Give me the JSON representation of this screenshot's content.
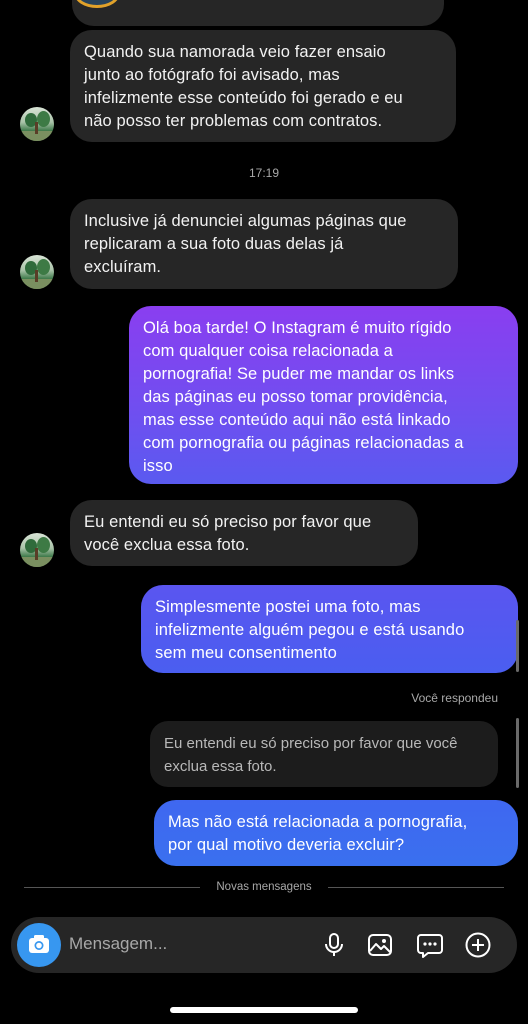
{
  "conversation": {
    "messages": [
      {
        "id": "m1",
        "direction": "incoming",
        "text": "Quando sua namorada veio  fazer ensaio\njunto ao fotógrafo foi avisado, mas\ninfelizmente esse conteúdo foi gerado e eu\nnão posso ter problemas com contratos."
      },
      {
        "id": "m2",
        "direction": "incoming",
        "text": "Inclusive já denunciei algumas páginas que\nreplicaram a sua foto duas delas já\nexcluíram."
      },
      {
        "id": "m3",
        "direction": "outgoing",
        "text": "Olá boa tarde! O Instagram é muito rígido\ncom qualquer coisa relacionada a\npornografia! Se puder me mandar os links\ndas páginas eu posso tomar providência,\nmas esse conteúdo aqui não está linkado\ncom pornografia ou páginas relacionadas a\nisso"
      },
      {
        "id": "m4",
        "direction": "incoming",
        "text": "Eu entendi eu só preciso por favor que\nvocê exclua essa foto."
      },
      {
        "id": "m5",
        "direction": "outgoing",
        "text": "Simplesmente postei uma foto, mas\ninfelizmente alguém pegou e está usando\nsem meu consentimento"
      },
      {
        "id": "m6",
        "direction": "outgoing",
        "text": "Mas não está relacionada a pornografia,\npor qual motivo deveria excluir?"
      }
    ],
    "timestamp": "17:19",
    "reply_label": "Você respondeu",
    "quoted_text": "Eu entendi eu só preciso por favor que você\nexclua essa foto.",
    "new_messages_label": "Novas mensagens"
  },
  "composer": {
    "placeholder": "Mensagem...",
    "icons": [
      "camera-icon",
      "microphone-icon",
      "gallery-icon",
      "sticker-icon",
      "plus-icon"
    ]
  },
  "colors": {
    "incoming_bubble": "#262626",
    "outgoing_gradient_top": "#8a3ef0",
    "outgoing_gradient_bottom": "#3d6bf0",
    "camera_button": "#3797f0",
    "background": "#000000"
  }
}
